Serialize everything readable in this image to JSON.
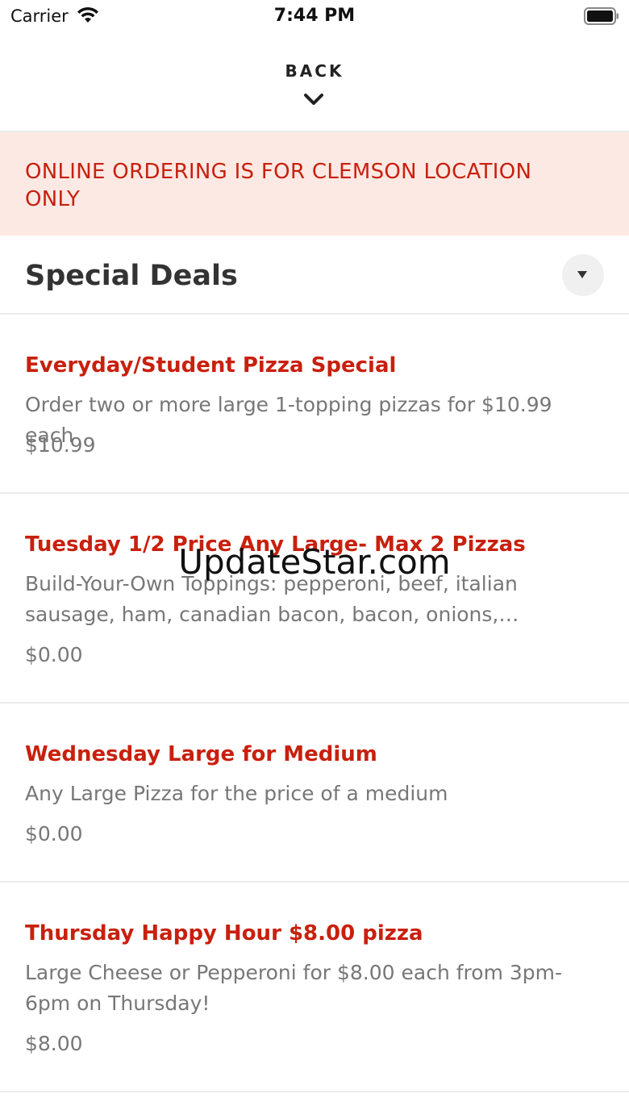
{
  "status_bar": {
    "carrier": "Carrier",
    "time": "7:44 PM",
    "icons": [
      "wifi-icon",
      "battery-icon"
    ]
  },
  "nav": {
    "back_label": "BACK",
    "icon": "chevron-down-icon"
  },
  "notice": {
    "text": "ONLINE ORDERING IS FOR CLEMSON LOCATION ONLY",
    "background": "#fde9e4",
    "color": "#c8200e"
  },
  "section": {
    "title": "Special Deals",
    "dropdown_icon": "caret-down-icon"
  },
  "deals": [
    {
      "title": "Everyday/Student Pizza Special",
      "description": "Order two or more large 1-topping pizzas for $10.99 each",
      "price": "$10.99"
    },
    {
      "title": "Tuesday 1/2 Price Any Large- Max 2 Pizzas",
      "description": "Build-Your-Own Toppings: pepperoni, beef, italian sausage, ham, canadian bacon, bacon, onions, mushrooms",
      "price": "$0.00"
    },
    {
      "title": "Wednesday Large for Medium",
      "description": "Any Large Pizza for the price of a medium",
      "price": "$0.00"
    },
    {
      "title": "Thursday Happy Hour $8.00 pizza",
      "description": "Large Cheese or Pepperoni for $8.00 each from 3pm-6pm on Thursday!",
      "price": "$8.00"
    }
  ],
  "watermark": "UpdateStar.com",
  "colors": {
    "accent": "#c8200e",
    "secondary_text": "#777777"
  }
}
